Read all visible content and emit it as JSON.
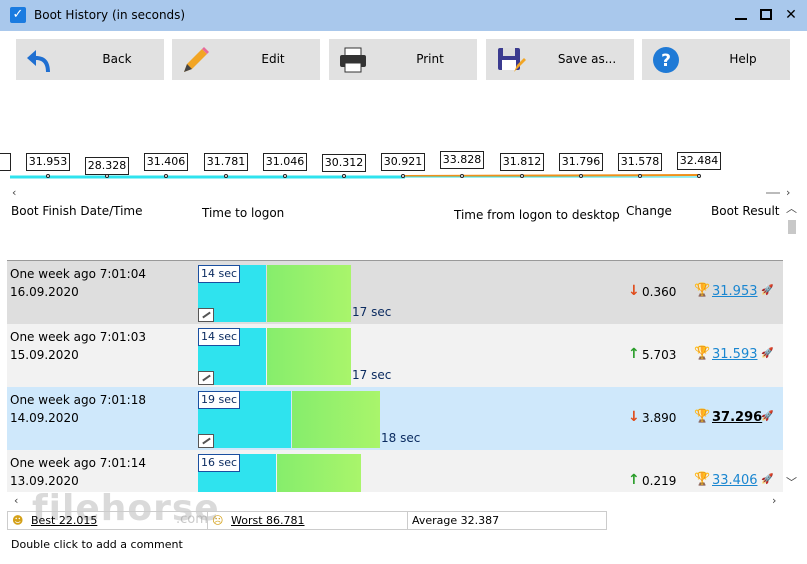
{
  "window": {
    "title": "Boot History (in seconds)",
    "minimize": "",
    "maximize": "",
    "close": "✕"
  },
  "toolbar": {
    "buttons": [
      {
        "id": "back",
        "label": "Back",
        "icon": "back-arrow-icon"
      },
      {
        "id": "edit",
        "label": "Edit",
        "icon": "pencil-icon"
      },
      {
        "id": "print",
        "label": "Print",
        "icon": "printer-icon"
      },
      {
        "id": "save",
        "label": "Save as...",
        "icon": "floppy-disk-icon"
      },
      {
        "id": "help",
        "label": "Help",
        "icon": "help-icon"
      }
    ]
  },
  "timeline": {
    "values": [
      "31.953",
      "28.328",
      "31.406",
      "31.781",
      "31.046",
      "30.312",
      "30.921",
      "33.828",
      "31.812",
      "31.796",
      "31.578",
      "32.484"
    ],
    "left_arrow": "‹",
    "right_arrow": "›",
    "line_color": "#2fe3ee",
    "accent_color": "#f0901a"
  },
  "columns": {
    "date": "Boot Finish Date/Time",
    "logon": "Time to logon",
    "desktop": "Time from logon to desktop",
    "change": "Change",
    "result": "Boot Result"
  },
  "rows": [
    {
      "date1": "One week ago  7:01:04",
      "date2": "16.09.2020",
      "logon": "14 sec",
      "desktop": "17 sec",
      "direction": "down",
      "arrow": "↓",
      "change": "0.360",
      "result": "31.953",
      "bg": "#dedede",
      "logon_frac": 0.18,
      "desktop_frac": 0.22
    },
    {
      "date1": "One week ago  7:01:03",
      "date2": "15.09.2020",
      "logon": "14 sec",
      "desktop": "17 sec",
      "direction": "up",
      "arrow": "↑",
      "change": "5.703",
      "result": "31.593",
      "bg": "#f2f2f2",
      "logon_frac": 0.18,
      "desktop_frac": 0.22
    },
    {
      "date1": "One week ago  7:01:18",
      "date2": "14.09.2020",
      "logon": "19 sec",
      "desktop": "18 sec",
      "direction": "down",
      "arrow": "↓",
      "change": "3.890",
      "result": "37.296",
      "bg": "#cfe8fb",
      "logon_frac": 0.245,
      "desktop_frac": 0.232,
      "selected": true
    },
    {
      "date1": "One week ago  7:01:14",
      "date2": "13.09.2020",
      "logon": "16 sec",
      "desktop": "",
      "direction": "up",
      "arrow": "↑",
      "change": "0.219",
      "result": "33.406",
      "bg": "#f2f2f2",
      "logon_frac": 0.205,
      "desktop_frac": 0.22
    }
  ],
  "status": {
    "best": "Best 22.015",
    "worst": "Worst 86.781",
    "average": "Average 32.387"
  },
  "hint": "Double click to add a comment",
  "watermark": {
    "brand": "filehorse",
    "suffix": ".com"
  },
  "colors": {
    "up": "#2a9d2a",
    "down": "#e04b1a",
    "link": "#1a86d0"
  }
}
